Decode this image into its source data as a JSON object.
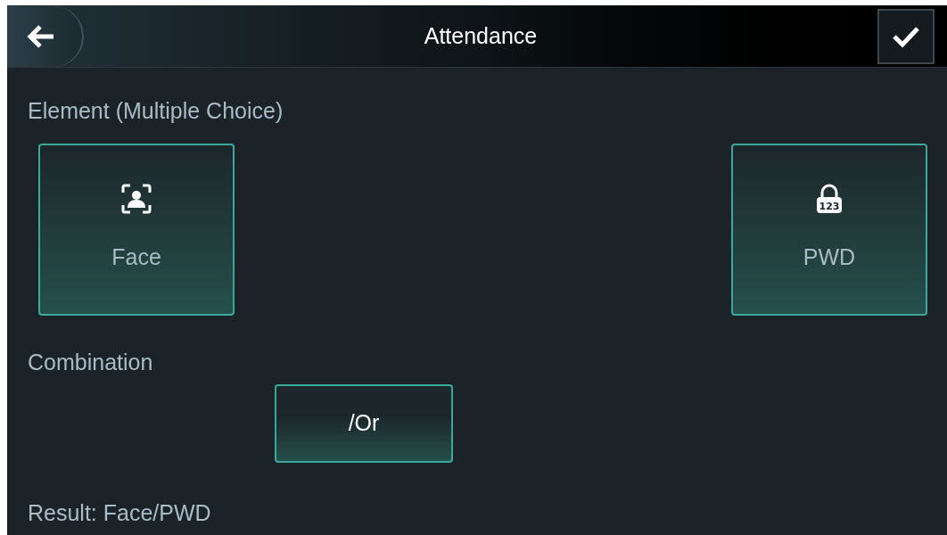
{
  "header": {
    "title": "Attendance"
  },
  "element_section": {
    "label": "Element (Multiple Choice)"
  },
  "elements": [
    {
      "kind": "face",
      "label": "Face",
      "selected": true
    },
    {
      "kind": "pwd",
      "label": "PWD",
      "selected": true,
      "icon_text": "123"
    }
  ],
  "combination": {
    "label": "Combination",
    "button": "/Or",
    "selected": true
  },
  "result": "Result: Face/PWD"
}
